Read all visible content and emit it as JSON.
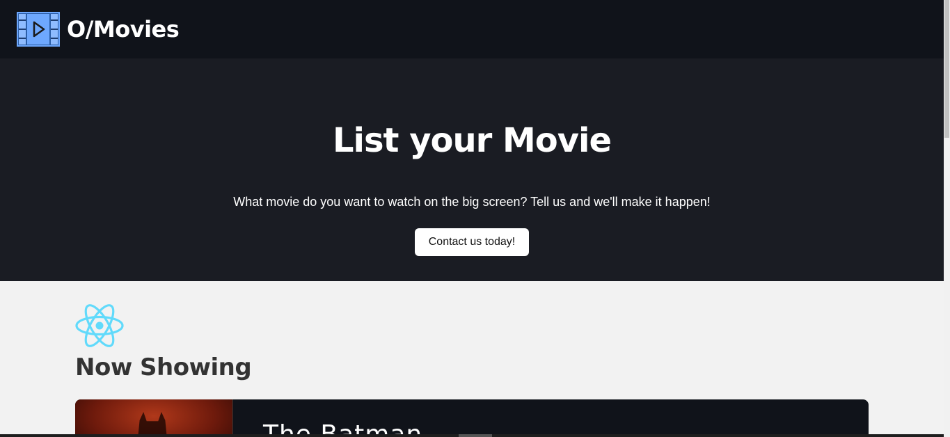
{
  "navbar": {
    "brand": "O/Movies",
    "logo_icon": "film-play-icon"
  },
  "hero": {
    "title": "List your Movie",
    "subtitle": "What movie do you want to watch on the big screen? Tell us and we'll make it happen!",
    "cta_label": "Contact us today!"
  },
  "section": {
    "icon": "react-atom-icon",
    "title": "Now Showing"
  },
  "movies": [
    {
      "title": "The Batman"
    }
  ],
  "colors": {
    "nav_bg": "#10131a",
    "hero_bg": "#1a1c23",
    "page_bg": "#f2f2f2",
    "react_blue": "#61dafb",
    "logo_blue": "#6ea8fe"
  }
}
